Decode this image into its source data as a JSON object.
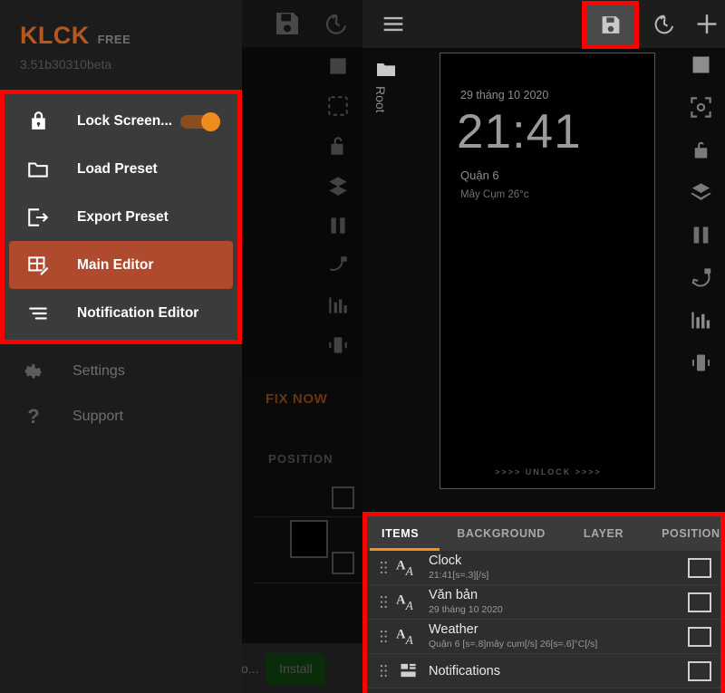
{
  "drawer": {
    "brand": "KLCK",
    "brand_badge": "FREE",
    "version": "3.51b30310beta",
    "highlight_color": "#b04a2e",
    "accent_color": "#b4581d",
    "items": [
      {
        "label": "Lock Screen...",
        "icon": "lock-icon",
        "toggle": "on"
      },
      {
        "label": "Load Preset",
        "icon": "folder-icon"
      },
      {
        "label": "Export Preset",
        "icon": "export-icon"
      },
      {
        "label": "Main Editor",
        "icon": "grid-edit-icon",
        "active": true
      },
      {
        "label": "Notification Editor",
        "icon": "lines-icon"
      }
    ],
    "lower_items": [
      {
        "label": "Settings",
        "icon": "gear-icon"
      },
      {
        "label": "Support",
        "icon": "question-icon"
      }
    ]
  },
  "background_app": {
    "fix_now": "FIX NOW",
    "position": "POSITION",
    "ad_text": "o...",
    "ad_button": "Install"
  },
  "editor": {
    "toolbar": {
      "menu": "menu-icon",
      "save": "save-icon",
      "history": "history-icon",
      "add": "plus-icon"
    },
    "tree_label": "Root",
    "preview": {
      "date": "29 tháng 10 2020",
      "time": "21:41",
      "location": "Quận 6",
      "weather": "Mây Cụm 26°c",
      "unlock": ">>>>  UNLOCK  >>>>"
    },
    "rail_icons": [
      "square-icon",
      "focus-icon",
      "unlock-icon",
      "layers-icon",
      "pause-icon",
      "rotate-lock-icon",
      "chart-icon",
      "vibrate-icon"
    ]
  },
  "items_panel": {
    "accent_color": "#f5901e",
    "tabs": [
      {
        "label": "ITEMS",
        "active": true
      },
      {
        "label": "BACKGROUND",
        "active": false
      },
      {
        "label": "LAYER",
        "active": false
      },
      {
        "label": "POSITION",
        "active": false
      }
    ],
    "rows": [
      {
        "title": "Clock",
        "sub": "21:41[s=.3][/s]",
        "icon": "text-icon",
        "checked": false
      },
      {
        "title": "Văn bản",
        "sub": "29 tháng 10 2020",
        "icon": "text-icon",
        "checked": false
      },
      {
        "title": "Weather",
        "sub": "Quận 6 [s=.8]mây cụm[/s] 26[s=.6]°C[/s]",
        "icon": "text-icon",
        "checked": false
      },
      {
        "title": "Notifications",
        "sub": "",
        "icon": "notification-list-icon",
        "checked": false
      }
    ]
  }
}
